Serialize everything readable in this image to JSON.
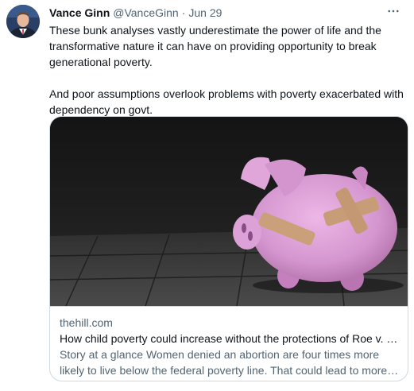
{
  "tweet": {
    "author_name": "Vance Ginn",
    "author_handle": "@VanceGinn",
    "separator": "·",
    "date": "Jun 29",
    "paragraphs": [
      "These bunk analyses vastly underestimate the power of life and the\ntransformative nature it can have on providing opportunity to break\ngenerational poverty.",
      "And poor assumptions overlook problems with poverty exacerbated with\ndependency on govt."
    ]
  },
  "card": {
    "image_subject": "piggy-bank-with-bandages",
    "domain": "thehill.com",
    "title": "How child poverty could increase without the protections of Roe v. W...",
    "description": "Story at a glance Women denied an abortion are four times more likely to live below the federal poverty line.  That could lead to more children..."
  },
  "colors": {
    "text_primary": "#0f1419",
    "text_secondary": "#536471",
    "border": "#cfd9de",
    "piggy_pink": "#d89ad3"
  },
  "icons": {
    "more": "more-horizontal-icon",
    "avatar": "avatar"
  }
}
